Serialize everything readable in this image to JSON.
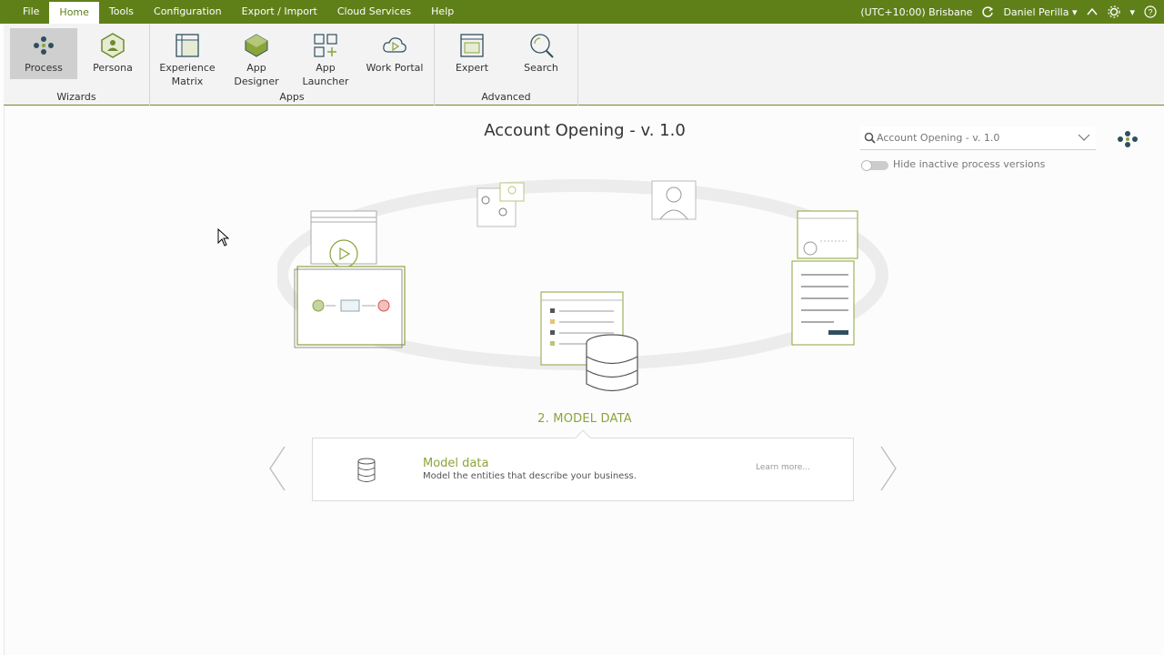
{
  "menubar": {
    "items": [
      "File",
      "Home",
      "Tools",
      "Configuration",
      "Export / Import",
      "Cloud Services",
      "Help"
    ],
    "timezone": "(UTC+10:00) Brisbane",
    "user": "Daniel Perilla"
  },
  "ribbon": {
    "wizards": {
      "label": "Wizards",
      "process": "Process",
      "persona": "Persona"
    },
    "apps": {
      "label": "Apps",
      "experience_matrix": "Experience\nMatrix",
      "app_designer": "App Designer",
      "app_launcher": "App Launcher",
      "work_portal": "Work Portal"
    },
    "advanced": {
      "label": "Advanced",
      "expert": "Expert",
      "search": "Search"
    }
  },
  "main": {
    "title": "Account Opening - v. 1.0",
    "search_value": "Account Opening - v. 1.0",
    "toggle_label": "Hide inactive process versions",
    "step_label": "2. MODEL DATA",
    "card": {
      "title": "Model data",
      "description": "Model the entities that describe your business.",
      "link": "Learn more..."
    }
  },
  "colors": {
    "brand_green": "#5f8019",
    "accent_green": "#8aa43a",
    "stop_red": "#d9534f"
  }
}
